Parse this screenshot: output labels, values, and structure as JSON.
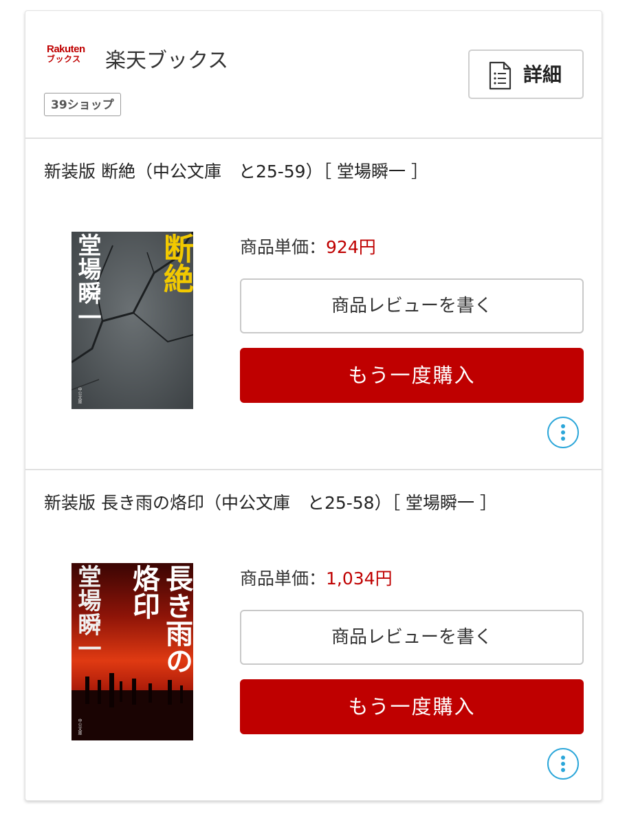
{
  "shop": {
    "logo_line1": "Rakuten",
    "logo_line2": "ブックス",
    "name": "楽天ブックス",
    "badge": "39ショップ",
    "detail_label": "詳細",
    "detail_icon": "document-list-icon"
  },
  "items": [
    {
      "title": "新装版 断絶（中公文庫　と25-59）［ 堂場瞬一 ］",
      "cover": {
        "author": "堂場瞬一",
        "title": "断絶",
        "publisher": "中公文庫"
      },
      "price_label": "商品単価：",
      "price_value": "924円",
      "review_label": "商品レビューを書く",
      "buy_label": "もう一度購入",
      "more_icon": "more-vertical-icon"
    },
    {
      "title": "新装版 長き雨の烙印（中公文庫　と25-58）［ 堂場瞬一 ］",
      "cover": {
        "author": "堂場瞬一",
        "title_line1": "長き雨の",
        "title_line2": "烙印",
        "publisher": "中公文庫"
      },
      "price_label": "商品単価：",
      "price_value": "1,034円",
      "review_label": "商品レビューを書く",
      "buy_label": "もう一度購入",
      "more_icon": "more-vertical-icon"
    }
  ],
  "colors": {
    "brand_red": "#bf0000",
    "price_red": "#bf0000",
    "accent_blue": "#2ba6d9",
    "border_gray": "#c8c8c8"
  }
}
